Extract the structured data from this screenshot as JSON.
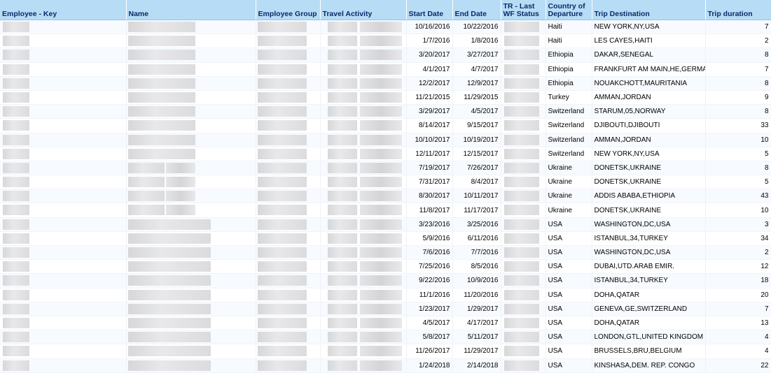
{
  "table": {
    "columns": [
      "Employee - Key",
      "Name",
      "Employee Group",
      "Travel Activity",
      "Start Date",
      "End Date",
      "TR - Last WF Status",
      "Country of Departure",
      "Trip Destination",
      "Trip duration"
    ],
    "rows": [
      {
        "start": "10/16/2016",
        "end": "10/22/2016",
        "country": "Haiti",
        "dest": "NEW YORK,NY,USA",
        "dur": "7"
      },
      {
        "start": "1/7/2016",
        "end": "1/8/2016",
        "country": "Haiti",
        "dest": "LES CAYES,HAITI",
        "dur": "2"
      },
      {
        "start": "3/20/2017",
        "end": "3/27/2017",
        "country": "Ethiopia",
        "dest": "DAKAR,SENEGAL",
        "dur": "8"
      },
      {
        "start": "4/1/2017",
        "end": "4/7/2017",
        "country": "Ethiopia",
        "dest": "FRANKFURT AM MAIN,HE,GERMAN",
        "dur": "7"
      },
      {
        "start": "12/2/2017",
        "end": "12/9/2017",
        "country": "Ethiopia",
        "dest": "NOUAKCHOTT,MAURITANIA",
        "dur": "8"
      },
      {
        "start": "11/21/2015",
        "end": "11/29/2015",
        "country": "Turkey",
        "dest": "AMMAN,JORDAN",
        "dur": "9"
      },
      {
        "start": "3/29/2017",
        "end": "4/5/2017",
        "country": "Switzerland",
        "dest": "STARUM,05,NORWAY",
        "dur": "8"
      },
      {
        "start": "8/14/2017",
        "end": "9/15/2017",
        "country": "Switzerland",
        "dest": "DJIBOUTI,DJIBOUTI",
        "dur": "33"
      },
      {
        "start": "10/10/2017",
        "end": "10/19/2017",
        "country": "Switzerland",
        "dest": "AMMAN,JORDAN",
        "dur": "10"
      },
      {
        "start": "12/11/2017",
        "end": "12/15/2017",
        "country": "Switzerland",
        "dest": "NEW YORK,NY,USA",
        "dur": "5"
      },
      {
        "start": "7/19/2017",
        "end": "7/26/2017",
        "country": "Ukraine",
        "dest": "DONETSK,UKRAINE",
        "dur": "8"
      },
      {
        "start": "7/31/2017",
        "end": "8/4/2017",
        "country": "Ukraine",
        "dest": "DONETSK,UKRAINE",
        "dur": "5"
      },
      {
        "start": "8/30/2017",
        "end": "10/11/2017",
        "country": "Ukraine",
        "dest": "ADDIS ABABA,ETHIOPIA",
        "dur": "43"
      },
      {
        "start": "11/8/2017",
        "end": "11/17/2017",
        "country": "Ukraine",
        "dest": "DONETSK,UKRAINE",
        "dur": "10"
      },
      {
        "start": "3/23/2016",
        "end": "3/25/2016",
        "country": "USA",
        "dest": "WASHINGTON,DC,USA",
        "dur": "3"
      },
      {
        "start": "5/9/2016",
        "end": "6/11/2016",
        "country": "USA",
        "dest": "ISTANBUL,34,TURKEY",
        "dur": "34"
      },
      {
        "start": "7/6/2016",
        "end": "7/7/2016",
        "country": "USA",
        "dest": "WASHINGTON,DC,USA",
        "dur": "2"
      },
      {
        "start": "7/25/2016",
        "end": "8/5/2016",
        "country": "USA",
        "dest": "DUBAI,UTD.ARAB EMIR.",
        "dur": "12"
      },
      {
        "start": "9/22/2016",
        "end": "10/9/2016",
        "country": "USA",
        "dest": "ISTANBUL,34,TURKEY",
        "dur": "18"
      },
      {
        "start": "11/1/2016",
        "end": "11/20/2016",
        "country": "USA",
        "dest": "DOHA,QATAR",
        "dur": "20"
      },
      {
        "start": "1/23/2017",
        "end": "1/29/2017",
        "country": "USA",
        "dest": "GENEVA,GE,SWITZERLAND",
        "dur": "7"
      },
      {
        "start": "4/5/2017",
        "end": "4/17/2017",
        "country": "USA",
        "dest": "DOHA,QATAR",
        "dur": "13"
      },
      {
        "start": "5/8/2017",
        "end": "5/11/2017",
        "country": "USA",
        "dest": "LONDON,GTL,UNITED KINGDOM",
        "dur": "4"
      },
      {
        "start": "11/26/2017",
        "end": "11/29/2017",
        "country": "USA",
        "dest": "BRUSSELS,BRU,BELGIUM",
        "dur": "4"
      },
      {
        "start": "1/24/2018",
        "end": "2/14/2018",
        "country": "USA",
        "dest": "KINSHASA,DEM. REP. CONGO",
        "dur": "22"
      }
    ]
  }
}
